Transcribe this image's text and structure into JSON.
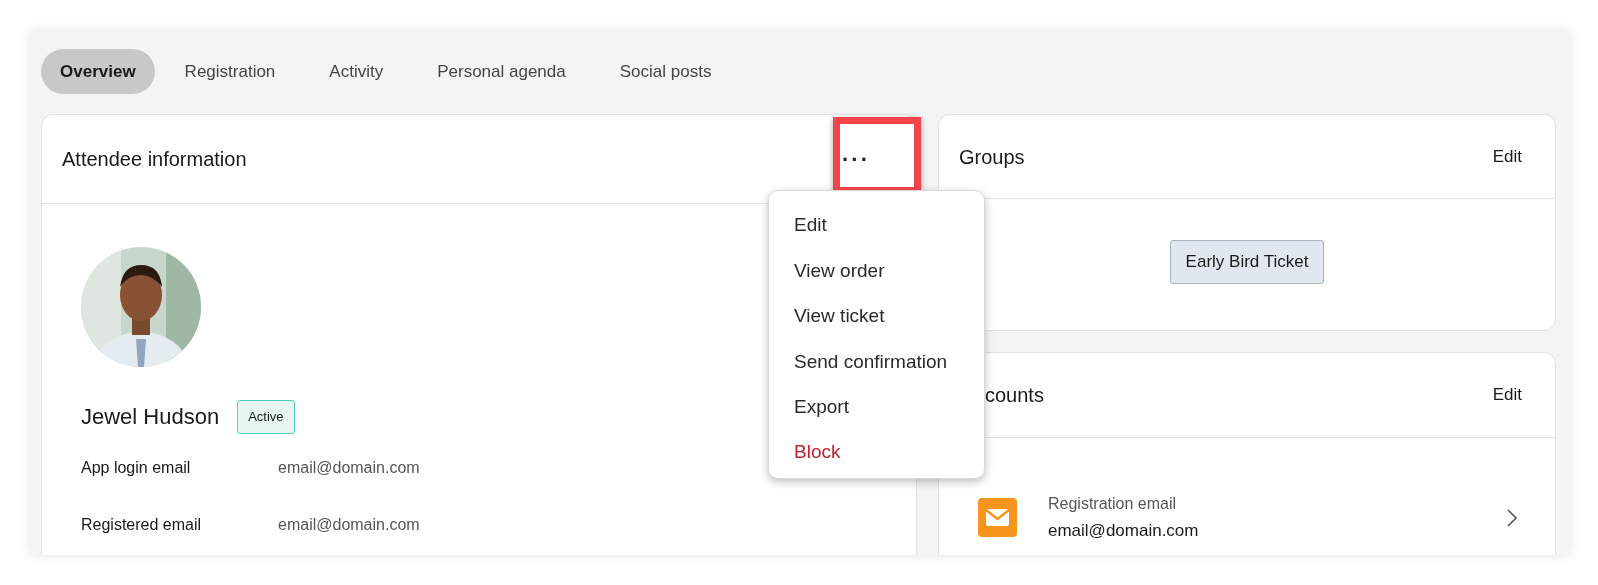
{
  "tabs": [
    {
      "label": "Overview",
      "selected": true
    },
    {
      "label": "Registration",
      "selected": false
    },
    {
      "label": "Activity",
      "selected": false
    },
    {
      "label": "Personal agenda",
      "selected": false
    },
    {
      "label": "Social posts",
      "selected": false
    }
  ],
  "attendee_card": {
    "title": "Attendee information",
    "more_button": "···",
    "name": "Jewel Hudson",
    "status": "Active",
    "fields": [
      {
        "label": "App login email",
        "value": "email@domain.com"
      },
      {
        "label": "Registered email",
        "value": "email@domain.com"
      }
    ]
  },
  "menu": [
    {
      "label": "Edit",
      "kind": "normal"
    },
    {
      "label": "View order",
      "kind": "normal"
    },
    {
      "label": "View ticket",
      "kind": "normal"
    },
    {
      "label": "Send confirmation",
      "kind": "normal"
    },
    {
      "label": "Export",
      "kind": "normal"
    },
    {
      "label": "Block",
      "kind": "danger"
    }
  ],
  "groups_card": {
    "title": "Groups",
    "edit": "Edit",
    "tags": [
      "Early Bird Ticket"
    ]
  },
  "accounts_card": {
    "title": "counts",
    "edit": "Edit",
    "items": [
      {
        "label": "Registration email",
        "value": "email@domain.com"
      }
    ]
  }
}
